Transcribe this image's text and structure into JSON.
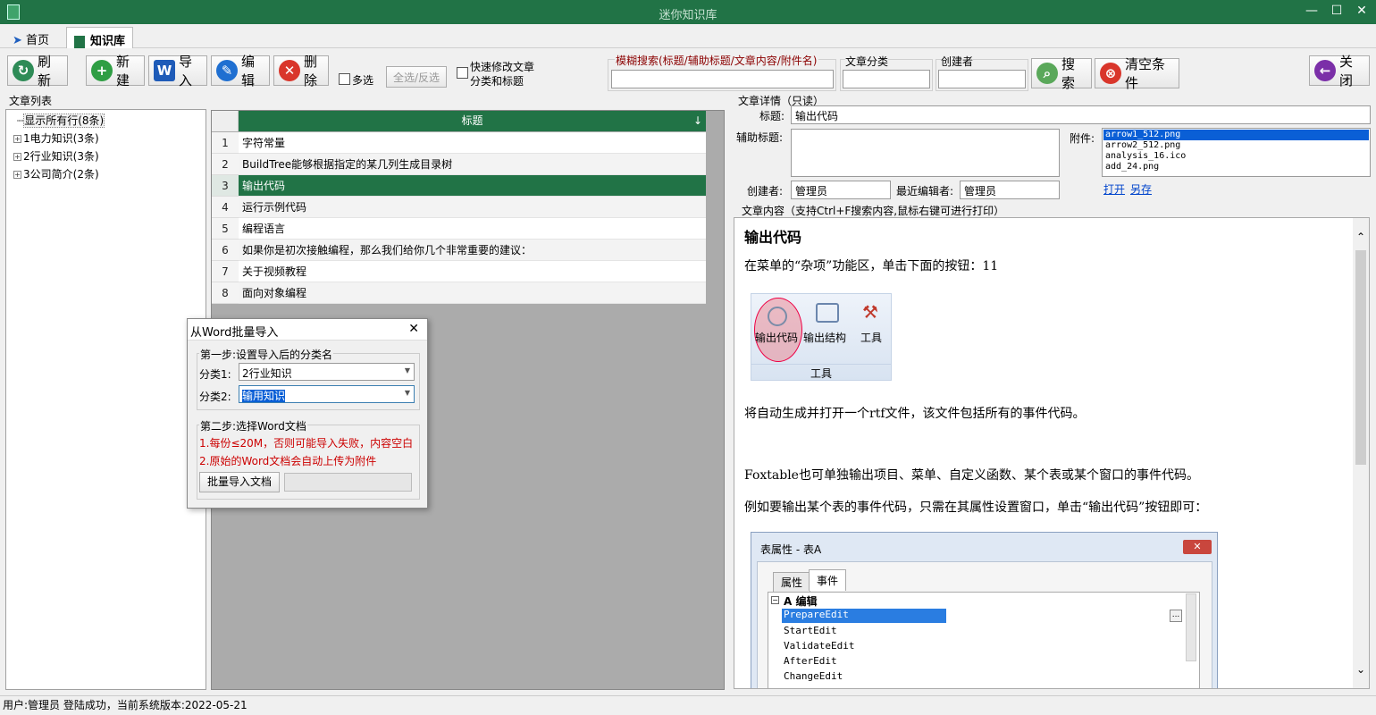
{
  "app": {
    "title": "迷你知识库"
  },
  "tabs": [
    {
      "label": "首页"
    },
    {
      "label": "知识库"
    }
  ],
  "toolbar": {
    "refresh": "刷新",
    "new": "新建",
    "import": "导入",
    "edit": "编辑",
    "delete": "删除",
    "multi": "多选",
    "select_all": "全选/反选",
    "quick_edit_line1": "快速修改文章",
    "quick_edit_line2": "分类和标题",
    "fuzzy_label": "模糊搜索(标题/辅助标题/文章内容/附件名)",
    "category_label": "文章分类",
    "creator_label": "创建者",
    "search": "搜索",
    "clear": "清空条件",
    "close": "关闭"
  },
  "article_list": {
    "label": "文章列表",
    "tree": [
      {
        "label": "显示所有行(8条)"
      },
      {
        "label": "1电力知识(3条)"
      },
      {
        "label": "2行业知识(3条)"
      },
      {
        "label": "3公司简介(2条)"
      }
    ]
  },
  "grid": {
    "header": "标题",
    "sort_icon": "↓",
    "rows": [
      {
        "n": "1",
        "title": "字符常量"
      },
      {
        "n": "2",
        "title": "BuildTree能够根据指定的某几列生成目录树"
      },
      {
        "n": "3",
        "title": "输出代码"
      },
      {
        "n": "4",
        "title": "运行示例代码"
      },
      {
        "n": "5",
        "title": "编程语言"
      },
      {
        "n": "6",
        "title": "如果你是初次接触编程，那么我们给你几个非常重要的建议："
      },
      {
        "n": "7",
        "title": "关于视频教程"
      },
      {
        "n": "8",
        "title": "面向对象编程"
      }
    ]
  },
  "detail": {
    "label": "文章详情（只读）",
    "title_label": "标题:",
    "title_value": "输出代码",
    "subtitle_label": "辅助标题:",
    "attach_label": "附件:",
    "attachments": [
      "arrow1_512.png",
      "arrow2_512.png",
      "analysis_16.ico",
      "add_24.png"
    ],
    "open": "打开",
    "save_as": "另存",
    "creator_label": "创建者:",
    "creator_value": "管理员",
    "editor_label": "最近编辑者:",
    "editor_value": "管理员",
    "content_label": "文章内容（支持Ctrl+F搜索内容,鼠标右键可进行打印）"
  },
  "content": {
    "heading": "输出代码",
    "p1": "在菜单的“杂项”功能区，单击下面的按钮：11",
    "ribbon": {
      "btn1": "输出代码",
      "btn2": "输出结构",
      "btn3": "工具",
      "group": "工具"
    },
    "p2": "将自动生成并打开一个rtf文件，该文件包括所有的事件代码。",
    "p3": "Foxtable也可单独输出项目、菜单、自定义函数、某个表或某个窗口的事件代码。",
    "p4": "例如要输出某个表的事件代码，只需在其属性设置窗口，单击“输出代码”按钮即可：",
    "props": {
      "title": "表属性 - 表A",
      "tab1": "属性",
      "tab2": "事件",
      "group": "A 编辑",
      "items": [
        "PrepareEdit",
        "StartEdit",
        "ValidateEdit",
        "AfterEdit",
        "ChangeEdit"
      ],
      "more": "..."
    }
  },
  "dialog": {
    "title": "从Word批量导入",
    "step1": "第一步:设置导入后的分类名",
    "cat1_label": "分类1:",
    "cat1_value": "2行业知识",
    "cat2_label": "分类2:",
    "cat2_value": "输用知识",
    "step2": "第二步:选择Word文档",
    "warn1": "1.每份≤20M，否则可能导入失败，内容空白",
    "warn2": "2.原始的Word文档会自动上传为附件",
    "batch_btn": "批量导入文档"
  },
  "status": {
    "text": "用户:管理员 登陆成功，当前系统版本:2022-05-21"
  },
  "colors": {
    "accent": "#217346",
    "warn": "#cc0000",
    "link": "#0044cc"
  }
}
